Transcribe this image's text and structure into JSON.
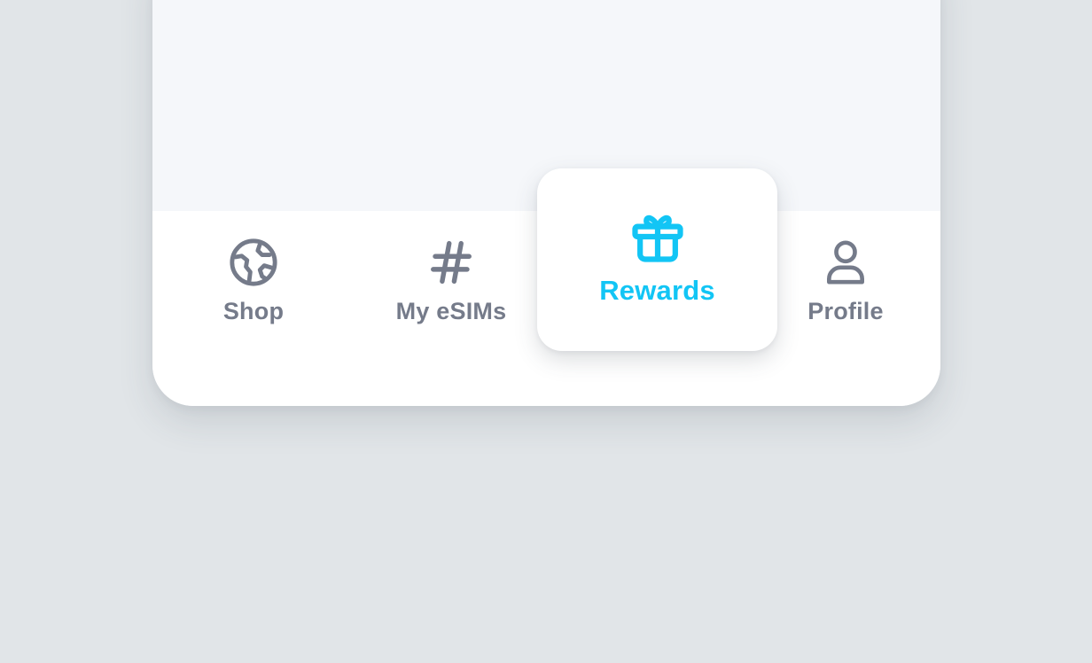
{
  "colors": {
    "background": "#e1e5e8",
    "content": "#f5f7fa",
    "tabbar": "#ffffff",
    "inactive": "#757b8a",
    "active": "#12c5f5"
  },
  "tabbar": {
    "tabs": [
      {
        "label": "Shop",
        "icon": "globe-icon",
        "active": false
      },
      {
        "label": "My eSIMs",
        "icon": "hash-icon",
        "active": false
      },
      {
        "label": "Rewards",
        "icon": "gift-icon",
        "active": true
      },
      {
        "label": "Profile",
        "icon": "user-icon",
        "active": false
      }
    ]
  }
}
